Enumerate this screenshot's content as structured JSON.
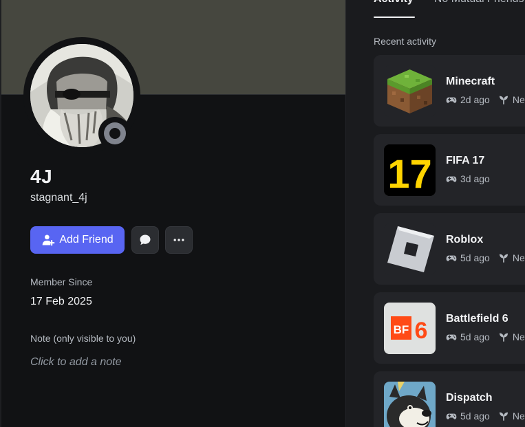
{
  "profile": {
    "display_name": "4J",
    "username": "stagnant_4j",
    "status": "offline",
    "banner_color": "#46473f",
    "add_friend_label": "Add Friend",
    "member_since_label": "Member Since",
    "member_since_date": "17 Feb 2025",
    "note_label": "Note (only visible to you)",
    "note_placeholder": "Click to add a note"
  },
  "tabs": [
    {
      "label": "Activity",
      "active": true
    },
    {
      "label": "No Mutual Friends",
      "active": false
    }
  ],
  "recent_activity_label": "Recent activity",
  "activities": [
    {
      "game": "Minecraft",
      "time": "2d ago",
      "extra": "New",
      "icon": "minecraft-icon"
    },
    {
      "game": "FIFA 17",
      "time": "3d ago",
      "extra": "",
      "icon": "fifa17-icon"
    },
    {
      "game": "Roblox",
      "time": "5d ago",
      "extra": "New",
      "icon": "roblox-icon"
    },
    {
      "game": "Battlefield 6",
      "time": "5d ago",
      "extra": "New",
      "icon": "battlefield6-icon"
    },
    {
      "game": "Dispatch",
      "time": "5d ago",
      "extra": "New",
      "icon": "dispatch-icon"
    }
  ],
  "icon_text": {
    "fifa": "17",
    "bf_left": "BF",
    "bf_right": "6"
  },
  "colors": {
    "accent": "#5865f2",
    "status_offline": "#80848e",
    "fifa_yellow": "#ffd400",
    "bf_orange": "#ff4a16"
  }
}
